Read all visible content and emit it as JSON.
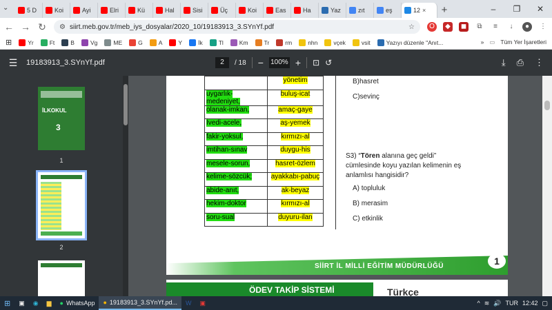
{
  "browser": {
    "tabs": [
      {
        "label": "5 D",
        "color": "#ff0000"
      },
      {
        "label": "Koi",
        "color": "#ff0000"
      },
      {
        "label": "Ayi",
        "color": "#ff0000"
      },
      {
        "label": "Elri",
        "color": "#ff0000"
      },
      {
        "label": "Kü",
        "color": "#ff0000"
      },
      {
        "label": "Hal",
        "color": "#ff0000"
      },
      {
        "label": "Sisi",
        "color": "#ff0000"
      },
      {
        "label": "Üç",
        "color": "#ff0000"
      },
      {
        "label": "Koi",
        "color": "#ff0000"
      },
      {
        "label": "Eas",
        "color": "#ff0000"
      },
      {
        "label": "Ha",
        "color": "#ff0000"
      },
      {
        "label": "Yaz",
        "color": "#2b6cb0"
      },
      {
        "label": "zıt",
        "color": "#4285f4"
      },
      {
        "label": "eş",
        "color": "#4285f4"
      },
      {
        "label": "12",
        "color": "#1e88e5"
      }
    ],
    "active_tab_close": "×",
    "new_tab": "+",
    "url": "siirt.meb.gov.tr/meb_iys_dosyalar/2020_10/19183913_3.SYnYf.pdf"
  },
  "bookmarks": [
    {
      "label": "Yr",
      "color": "#ff0000"
    },
    {
      "label": "Ft",
      "color": "#27ae60"
    },
    {
      "label": "B",
      "color": "#2c3e50"
    },
    {
      "label": "Vg",
      "color": "#8e44ad"
    },
    {
      "label": "ME",
      "color": "#7f8c8d"
    },
    {
      "label": "G",
      "color": "#ea4335"
    },
    {
      "label": "A",
      "color": "#f39c12"
    },
    {
      "label": "Y",
      "color": "#ff0000"
    },
    {
      "label": "İk",
      "color": "#1877f2"
    },
    {
      "label": "Tl",
      "color": "#16a085"
    },
    {
      "label": "Km",
      "color": "#9b59b6"
    },
    {
      "label": "Tr",
      "color": "#e67e22"
    },
    {
      "label": "rm",
      "color": "#c0392b"
    },
    {
      "label": "nhn",
      "color": "#f1c40f"
    },
    {
      "label": "vçek",
      "color": "#f1c40f"
    },
    {
      "label": "vsit",
      "color": "#f1c40f"
    },
    {
      "label": "Yazıyı düzenle \"Anıt...",
      "color": "#2b6cb0"
    }
  ],
  "bookmarks_more": "»",
  "bookmarks_all": "Tüm Yer İşaretleri",
  "pdf": {
    "title": "19183913_3.SYnYf.pdf",
    "page_current": "2",
    "page_total": "/ 18",
    "zoom": "100%",
    "thumb1_label": "1",
    "thumb2_label": "2",
    "thumb1_text1": "İLKOKUL",
    "thumb1_text2": "3"
  },
  "table": [
    {
      "left": "",
      "right": "yönetim"
    },
    {
      "left": "uygarlık-medeniyet,",
      "right": "buluş-icat"
    },
    {
      "left": "olanak-imkan,",
      "right": "amaç-gaye"
    },
    {
      "left": "İvedi-acele,",
      "right": "aş-yemek"
    },
    {
      "left": "fakir-yoksul,",
      "right": "kırmızı-al"
    },
    {
      "left": "imtihan-sınav",
      "right": "duygu-his"
    },
    {
      "left": "mesele-sorun,",
      "right": "hasret-özlem"
    },
    {
      "left": "kelime-sözcük;",
      "right": "ayakkabı-pabuç"
    },
    {
      "left": "abide-anıt,",
      "right": "ak-beyaz"
    },
    {
      "left": "hekim-doktor",
      "right": "kırmızı-al"
    },
    {
      "left": "soru-sual",
      "right": "duyuru-ilan"
    }
  ],
  "questions": {
    "b_prev": "B)hasret",
    "c_prev": "C)sevinç",
    "s3_prefix": "S3) “",
    "s3_bold": "Tören",
    "s3_rest": " alanına geç geldi”",
    "s3_line2": "cümlesinde koyu yazılan kelimenin eş",
    "s3_line3": "anlamlısı hangisidir?",
    "a": "A) topluluk",
    "b": "B) merasim",
    "c": "C) etkinlik"
  },
  "footer": {
    "text": "SİİRT İL MİLLİ EĞİTİM MÜDÜRLÜĞÜ",
    "page_number": "1"
  },
  "page2": {
    "band_text": "ÖDEV TAKİP SİSTEMİ",
    "side_text": "Türkçe"
  },
  "taskbar": {
    "apps": [
      {
        "label": "WhatsApp"
      },
      {
        "label": "19183913_3.SYnYf.pd..."
      }
    ],
    "lang": "TUR",
    "time": "12:42"
  }
}
